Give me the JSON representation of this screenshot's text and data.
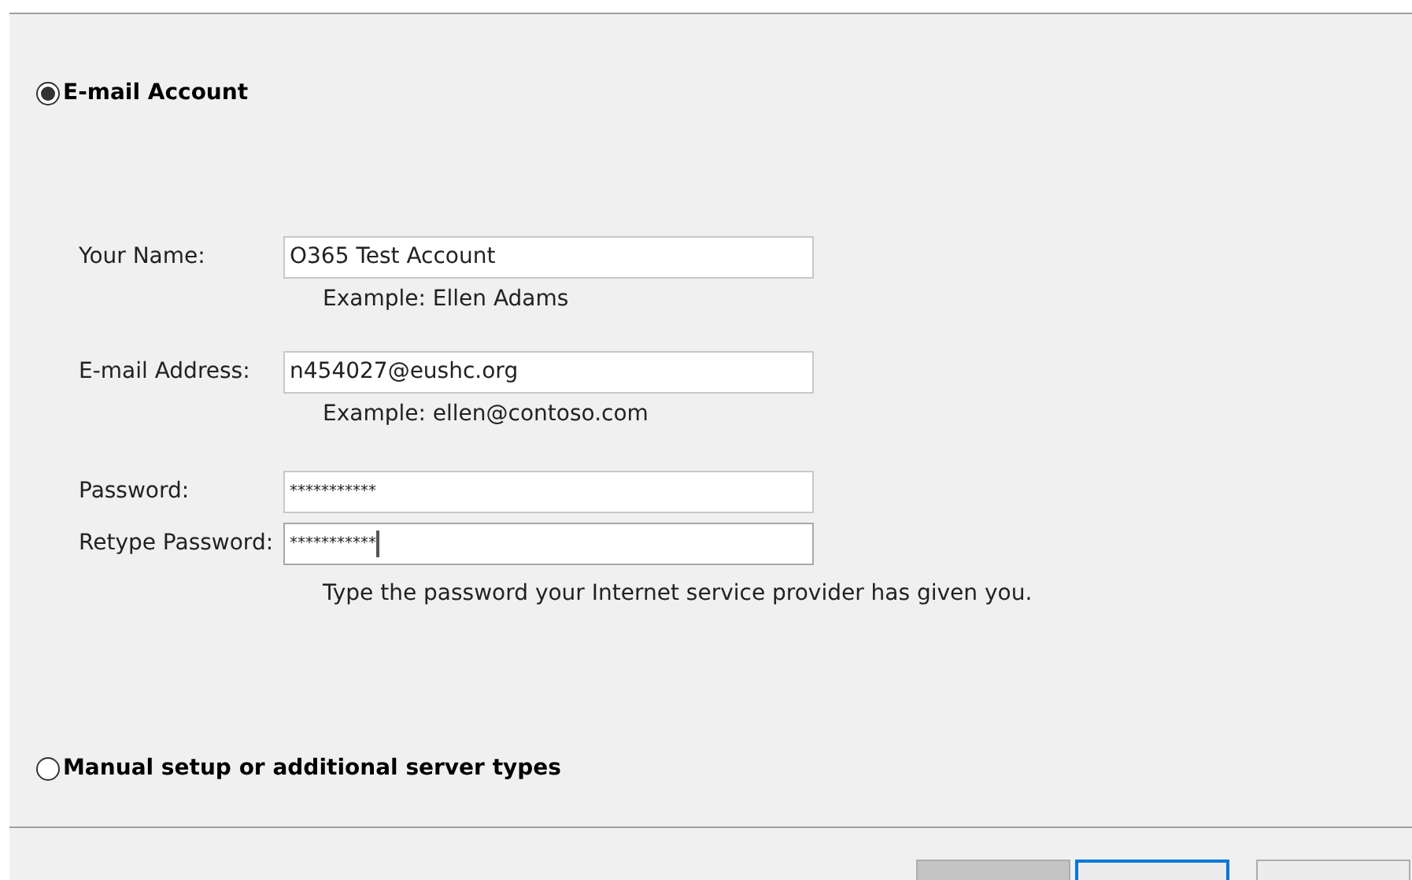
{
  "options": [
    {
      "label": "E-mail Account",
      "selected": true
    },
    {
      "label": "Manual setup or additional server types",
      "selected": false
    }
  ],
  "fields": [
    {
      "label": "Your Name:",
      "value": "O365 Test Account",
      "example": "Example: Ellen Adams",
      "focused": false
    },
    {
      "label": "E-mail Address:",
      "value": "n454027@eushc.org",
      "example": "Example: ellen@contoso.com",
      "focused": false
    },
    {
      "label": "Password:",
      "value": "***********",
      "focused": false
    },
    {
      "label": "Retype Password:",
      "value": "***********",
      "focused": true
    }
  ],
  "hint": "Type the password your Internet service provider has given you.",
  "buttons": [
    {
      "disabled": true,
      "focused": false
    },
    {
      "disabled": false,
      "focused": true
    },
    {
      "disabled": false,
      "focused": false
    }
  ]
}
